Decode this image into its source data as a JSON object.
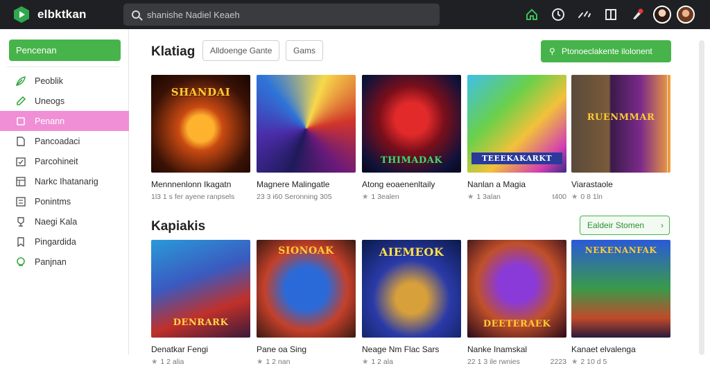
{
  "app": {
    "name": "elbktkan"
  },
  "search": {
    "placeholder": "shanishe Nadiel Keaeh"
  },
  "colors": {
    "accent": "#46b44a",
    "active_nav": "#f08fd6",
    "topbar": "#1f2023"
  },
  "topbar_icons": [
    "home-icon",
    "clock-icon",
    "controller-icon",
    "library-icon",
    "notification-icon"
  ],
  "sidebar": {
    "primary_button": "Pencenan",
    "items": [
      {
        "label": "Peoblik",
        "icon": "leaf-icon"
      },
      {
        "label": "Uneogs",
        "icon": "edit-icon"
      },
      {
        "label": "Penann",
        "icon": "tag-icon"
      },
      {
        "label": "Pancoadaci",
        "icon": "folder-icon"
      },
      {
        "label": "Parcohineit",
        "icon": "calendar-icon"
      },
      {
        "label": "Narkc Ihatanarig",
        "icon": "grid-icon"
      },
      {
        "label": "Ponintms",
        "icon": "list-icon"
      },
      {
        "label": "Naegi Kala",
        "icon": "trophy-icon"
      },
      {
        "label": "Pingardida",
        "icon": "bookmark-icon"
      },
      {
        "label": "Panjnan",
        "icon": "support-icon"
      }
    ]
  },
  "section1": {
    "title": "Klatiag",
    "chips": [
      "Alldoenge Gante",
      "Gams"
    ],
    "action_button": "Ptonoeclakente ilolonent",
    "cards": [
      {
        "thumb_text": "SHANDAI",
        "name": "Mennnenlonn Ikagatn",
        "meta_left": "1l3 1 s fer ayene ranpsels",
        "meta_right": ""
      },
      {
        "thumb_text": "",
        "name": "Magnere Malingatle",
        "meta_left": "23 3 i60 Seronning 305",
        "meta_right": ""
      },
      {
        "thumb_text": "THIMADAK",
        "name": "Atong eoaenenltaily",
        "meta_left": "1 3ealen",
        "meta_right": ""
      },
      {
        "thumb_text": "TEEEKAKARKT",
        "name": "Nanlan a Magia",
        "meta_left": "1 3alan",
        "meta_right": "t400"
      },
      {
        "thumb_text": "RUENMMAR",
        "name": "Viarastaole",
        "meta_left": "0 8 1ln",
        "meta_right": ""
      }
    ]
  },
  "section2": {
    "title": "Kapiakis",
    "action_button": "Ealdeir Stomen",
    "cards": [
      {
        "thumb_text": "DENRARK",
        "name": "Denatkar Fengi",
        "meta_left": "1 2 alia",
        "meta_right": ""
      },
      {
        "thumb_text": "SIONOAK",
        "name": "Pane oa Sing",
        "meta_left": "1 2 nan",
        "meta_right": ""
      },
      {
        "thumb_text": "AIEMEOK",
        "name": "Neage Nm Flac Sars",
        "meta_left": "1 2 ala",
        "meta_right": ""
      },
      {
        "thumb_text": "DEETERAEK",
        "name": "Nanke Inamskal",
        "meta_left": "22 1 3 ile rwnies",
        "meta_right": "2223"
      },
      {
        "thumb_text": "NEKENANFAK",
        "name": "Kanaet elvalenga",
        "meta_left": "2 10 d 5",
        "meta_right": ""
      }
    ]
  }
}
